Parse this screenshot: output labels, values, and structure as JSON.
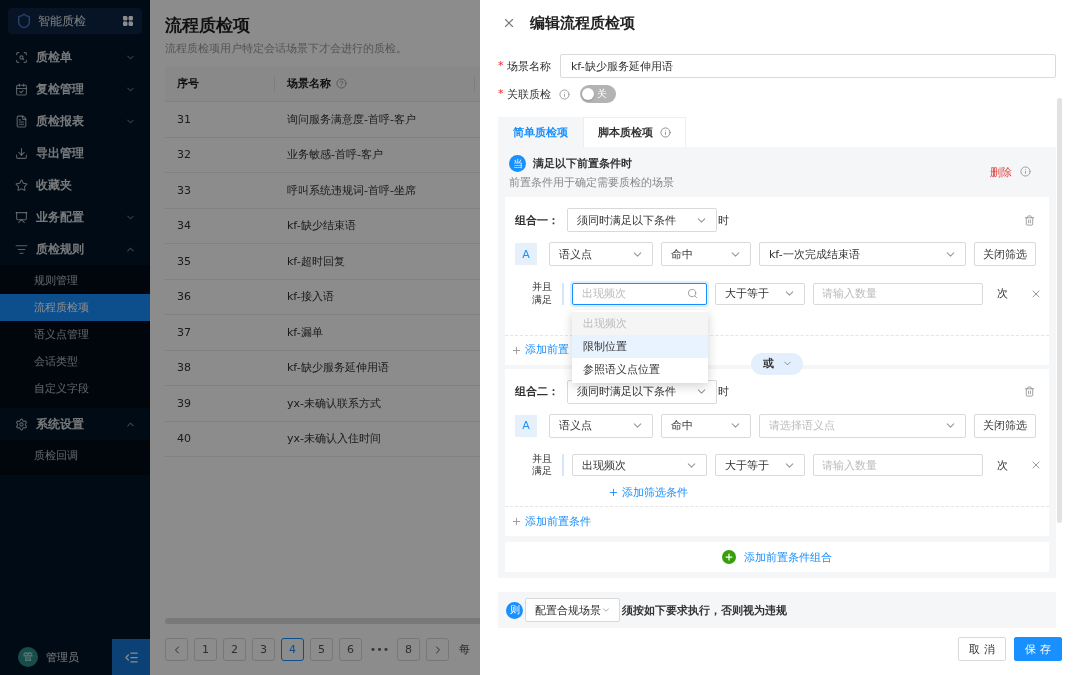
{
  "sidebar": {
    "brand": "智能质检",
    "menu": [
      {
        "label": "质检单",
        "expanded": false
      },
      {
        "label": "复检管理",
        "expanded": false
      },
      {
        "label": "质检报表",
        "expanded": false
      },
      {
        "label": "导出管理"
      },
      {
        "label": "收藏夹"
      },
      {
        "label": "业务配置",
        "expanded": false
      },
      {
        "label": "质检规则",
        "expanded": true,
        "children": [
          {
            "label": "规则管理",
            "selected": false
          },
          {
            "label": "流程质检项",
            "selected": true
          },
          {
            "label": "语义点管理",
            "selected": false
          },
          {
            "label": "会话类型",
            "selected": false
          },
          {
            "label": "自定义字段",
            "selected": false
          }
        ]
      },
      {
        "label": "系统设置",
        "expanded": true,
        "children": [
          {
            "label": "质检回调",
            "selected": false
          }
        ]
      }
    ],
    "user": {
      "avatar": "管",
      "name": "管理员"
    }
  },
  "page": {
    "title": "流程质检项",
    "description": "流程质检项用户特定会话场景下才会进行的质检。",
    "table": {
      "columns": [
        {
          "label": "序号",
          "help": false
        },
        {
          "label": "场景名称",
          "help": true
        }
      ],
      "rows": [
        [
          "31",
          "询问服务满意度-首呼-客户"
        ],
        [
          "32",
          "业务敏感-首呼-客户"
        ],
        [
          "33",
          "呼叫系统违规词-首呼-坐席"
        ],
        [
          "34",
          "kf-缺少结束语"
        ],
        [
          "35",
          "kf-超时回复"
        ],
        [
          "36",
          "kf-接入语"
        ],
        [
          "37",
          "kf-漏单"
        ],
        [
          "38",
          "kf-缺少服务延伸用语"
        ],
        [
          "39",
          "yx-未确认联系方式"
        ],
        [
          "40",
          "yx-未确认入住时间"
        ]
      ]
    },
    "pagination": {
      "pages": [
        {
          "kind": "page",
          "label": "1",
          "selected": false
        },
        {
          "kind": "page",
          "label": "2",
          "selected": false
        },
        {
          "kind": "page",
          "label": "3",
          "selected": false
        },
        {
          "kind": "page",
          "label": "4",
          "selected": true
        },
        {
          "kind": "page",
          "label": "5",
          "selected": false
        },
        {
          "kind": "page",
          "label": "6",
          "selected": false
        },
        {
          "kind": "ellipsis",
          "label": "•••"
        },
        {
          "kind": "page",
          "label": "8",
          "selected": false
        }
      ],
      "size_label": "每"
    }
  },
  "drawer": {
    "title": "编辑流程质检项",
    "scene_name": {
      "required_mark": "*",
      "label": "场景名称",
      "value": "kf-缺少服务延伸用语"
    },
    "linked": {
      "required_mark": "*",
      "label": "关联质检",
      "on": false,
      "switch_text": "关"
    },
    "tabs": [
      {
        "label": "简单质检项",
        "selected": true,
        "info": false
      },
      {
        "label": "脚本质检项",
        "selected": false,
        "info": true
      }
    ],
    "precondition": {
      "badge": "当",
      "title": "满足以下前置条件时",
      "subtitle": "前置条件用于确定需要质检的场景",
      "delete": "删除",
      "groups": [
        {
          "label": "组合一：",
          "mode": "须同时满足以下条件",
          "suffix": "时",
          "condition": {
            "tag": "A",
            "type": "语义点",
            "match": "命中",
            "target": {
              "value": "kf-一次完成结束语"
            },
            "filter_button": "关闭筛选",
            "filter": {
              "label": "并且满足",
              "field": {
                "placeholder": "出现频次",
                "focused": true
              },
              "operator": "大于等于",
              "count_placeholder": "请输入数量",
              "unit": "次",
              "options": [
                {
                  "label": "出现频次",
                  "disabled": true,
                  "highlighted": false
                },
                {
                  "label": "限制位置",
                  "disabled": false,
                  "highlighted": true
                },
                {
                  "label": "参照语义点位置",
                  "disabled": false,
                  "highlighted": false
                }
              ]
            }
          },
          "add_condition": "添加前置"
        },
        {
          "label": "组合二：",
          "mode": "须同时满足以下条件",
          "suffix": "时",
          "condition": {
            "tag": "A",
            "type": "语义点",
            "match": "命中",
            "target": {
              "placeholder": "请选择语义点"
            },
            "filter_button": "关闭筛选",
            "filter": {
              "label": "并且满足",
              "field": {
                "value": "出现频次",
                "focused": false
              },
              "operator": "大于等于",
              "count_placeholder": "请输入数量",
              "unit": "次"
            },
            "add_filter": "添加筛选条件"
          },
          "add_condition": "添加前置条件"
        }
      ],
      "connector": "或",
      "add_group": "添加前置条件组合"
    },
    "rule": {
      "badge": "则",
      "select": "配置合规场景",
      "text": "须按如下要求执行，否则视为违规"
    },
    "buttons": [
      {
        "label": "取 消",
        "kind": "default"
      },
      {
        "label": "保 存",
        "kind": "primary"
      }
    ]
  }
}
